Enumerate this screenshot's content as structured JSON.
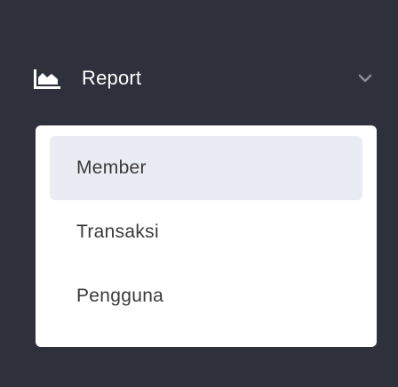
{
  "nav": {
    "section_label": "Report",
    "icon": "area-chart-icon",
    "expand_icon": "chevron-down-icon",
    "items": [
      {
        "label": "Member",
        "active": true
      },
      {
        "label": "Transaksi",
        "active": false
      },
      {
        "label": "Pengguna",
        "active": false
      }
    ]
  },
  "colors": {
    "sidebar_bg": "#2e303b",
    "submenu_bg": "#ffffff",
    "active_item_bg": "#eaecf4",
    "item_text": "#3a3a3a",
    "header_text": "#ffffff",
    "chevron": "#8a8d99"
  }
}
